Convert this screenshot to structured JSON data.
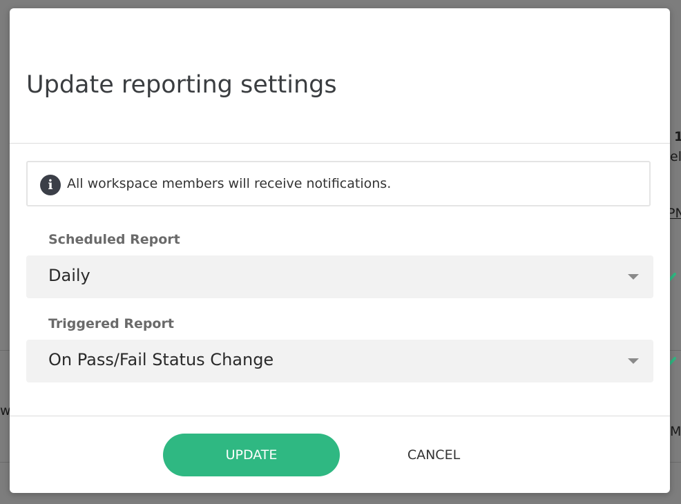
{
  "background": {
    "fragments": [
      "1",
      "el",
      "PN",
      "w",
      "M"
    ],
    "check_color": "#2fb882"
  },
  "modal": {
    "title": "Update reporting settings",
    "info": {
      "icon": "info-icon",
      "glyph": "i",
      "text": "All workspace members will receive notifications."
    },
    "scheduled_report": {
      "label": "Scheduled Report",
      "value": "Daily"
    },
    "triggered_report": {
      "label": "Triggered Report",
      "value": "On Pass/Fail Status Change"
    },
    "buttons": {
      "update": "UPDATE",
      "cancel": "CANCEL"
    }
  },
  "colors": {
    "accent": "#2fb882",
    "title": "#3a3d40",
    "label": "#6a6a6a",
    "select_bg": "#f2f2f2"
  }
}
